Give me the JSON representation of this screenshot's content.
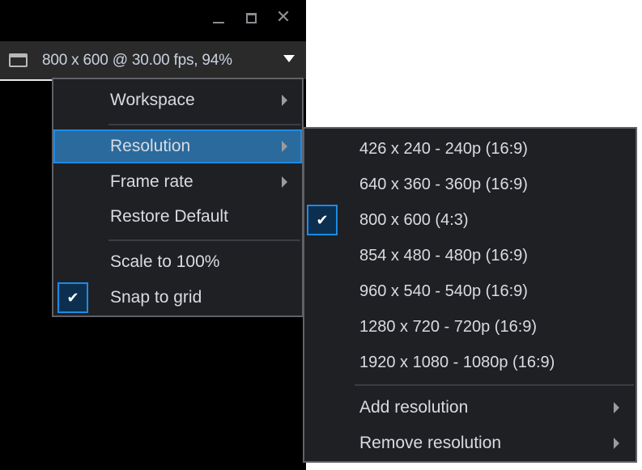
{
  "window": {
    "controls": {
      "minimize_icon": "minimize-icon",
      "maximize_icon": "maximize-icon",
      "close_icon": "close-icon",
      "close_glyph": "✕"
    }
  },
  "status_bar": {
    "icon": "display-icon",
    "text": "800 x 600 @ 30.00 fps, 94%",
    "dropdown_icon": "caret-down-icon"
  },
  "main_menu": {
    "items": [
      {
        "label": "Workspace",
        "has_submenu": true,
        "checked": false,
        "highlighted": false
      },
      {
        "label": "Resolution",
        "has_submenu": true,
        "checked": false,
        "highlighted": true
      },
      {
        "label": "Frame rate",
        "has_submenu": true,
        "checked": false,
        "highlighted": false
      },
      {
        "label": "Restore Default",
        "has_submenu": false,
        "checked": false,
        "highlighted": false
      },
      {
        "label": "Scale to 100%",
        "has_submenu": false,
        "checked": false,
        "highlighted": false
      },
      {
        "label": "Snap to grid",
        "has_submenu": false,
        "checked": true,
        "highlighted": false
      }
    ]
  },
  "resolution_submenu": {
    "items": [
      {
        "label": "426 x 240 - 240p (16:9)",
        "checked": false
      },
      {
        "label": "640 x 360 - 360p (16:9)",
        "checked": false
      },
      {
        "label": "800 x 600 (4:3)",
        "checked": true
      },
      {
        "label": "854 x 480 - 480p (16:9)",
        "checked": false
      },
      {
        "label": "960 x 540 - 540p (16:9)",
        "checked": false
      },
      {
        "label": "1280 x 720 - 720p (16:9)",
        "checked": false
      },
      {
        "label": "1920 x 1080 - 1080p (16:9)",
        "checked": false
      }
    ],
    "actions": [
      {
        "label": "Add resolution",
        "has_submenu": true
      },
      {
        "label": "Remove resolution",
        "has_submenu": true
      }
    ]
  },
  "check_glyph": "✔",
  "colors": {
    "highlight_bg": "#2b6a9c",
    "highlight_border": "#1e8ae6",
    "menu_bg": "#1f2024",
    "status_text": "#c9d1e0"
  }
}
